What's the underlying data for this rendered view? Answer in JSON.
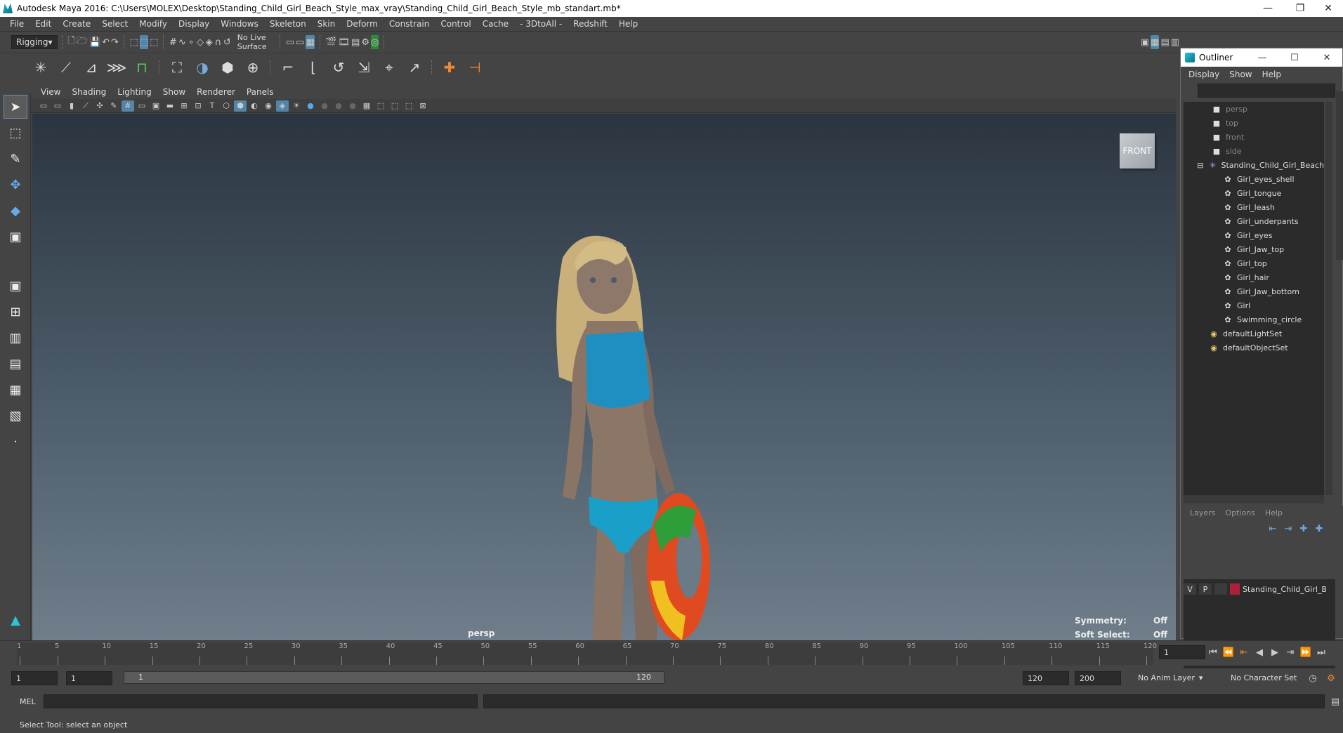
{
  "window": {
    "title": "Autodesk Maya 2016: C:\\Users\\MOLEX\\Desktop\\Standing_Child_Girl_Beach_Style_max_vray\\Standing_Child_Girl_Beach_Style_mb_standart.mb*"
  },
  "menubar": [
    "File",
    "Edit",
    "Create",
    "Select",
    "Modify",
    "Display",
    "Windows",
    "Skeleton",
    "Skin",
    "Deform",
    "Constrain",
    "Control",
    "Cache",
    "- 3DtoAll -",
    "Redshift",
    "Help"
  ],
  "toolbar": {
    "mode": "Rigging",
    "live_surface": "No Live Surface"
  },
  "viewport": {
    "menu": [
      "View",
      "Shading",
      "Lighting",
      "Show",
      "Renderer",
      "Panels"
    ],
    "camera_label": "persp",
    "view_cube": "FRONT",
    "symmetry_label": "Symmetry:",
    "symmetry_value": "Off",
    "soft_select_label": "Soft Select:",
    "soft_select_value": "Off"
  },
  "outliner": {
    "title": "Outliner",
    "menu": [
      "Display",
      "Show",
      "Help"
    ],
    "cameras": [
      "persp",
      "top",
      "front",
      "side"
    ],
    "group": "Standing_Child_Girl_Beach",
    "children": [
      "Girl_eyes_shell",
      "Girl_tongue",
      "Girl_leash",
      "Girl_underpants",
      "Girl_eyes",
      "Girl_Jaw_top",
      "Girl_top",
      "Girl_hair",
      "Girl_Jaw_bottom",
      "Girl",
      "Swimming_circle"
    ],
    "sets": [
      "defaultLightSet",
      "defaultObjectSet"
    ]
  },
  "layers": {
    "menu": [
      "Layers",
      "Options",
      "Help"
    ],
    "row": {
      "v": "V",
      "p": "P",
      "name": "Standing_Child_Girl_B",
      "color": "#b0203a"
    }
  },
  "timeline": {
    "ticks": [
      "1",
      "5",
      "10",
      "15",
      "20",
      "25",
      "30",
      "35",
      "40",
      "45",
      "50",
      "55",
      "60",
      "65",
      "70",
      "75",
      "80",
      "85",
      "90",
      "95",
      "100",
      "105",
      "110",
      "115",
      "120"
    ],
    "current_frame": "1"
  },
  "range": {
    "start": "1",
    "playback_start": "1",
    "slider_start": "1",
    "slider_end": "120",
    "playback_end": "120",
    "end": "200",
    "anim_layer": "No Anim Layer",
    "character_set": "No Character Set"
  },
  "cmdline": {
    "label": "MEL"
  },
  "status": {
    "text": "Select Tool: select an object"
  }
}
